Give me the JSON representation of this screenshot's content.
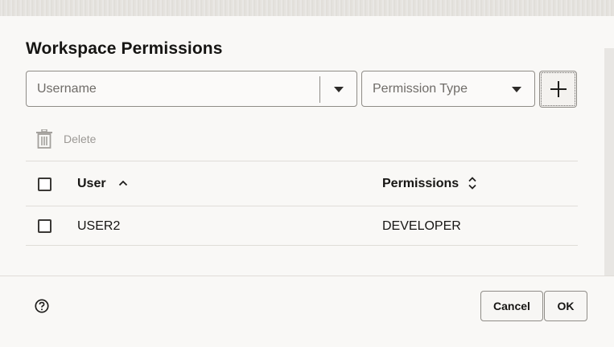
{
  "dialog": {
    "title": "Workspace Permissions"
  },
  "form": {
    "username_placeholder": "Username",
    "permission_placeholder": "Permission Type"
  },
  "toolbar": {
    "delete_label": "Delete"
  },
  "table": {
    "columns": [
      "User",
      "Permissions"
    ],
    "rows": [
      {
        "user": "USER2",
        "permission": "DEVELOPER"
      }
    ]
  },
  "footer": {
    "cancel_label": "Cancel",
    "ok_label": "OK"
  },
  "icons": {
    "add": "plus-icon",
    "delete": "trash-icon",
    "help": "question-circle-icon",
    "sort_user": "chevron-up-icon",
    "sort_permissions": "sort-updown-icon"
  }
}
